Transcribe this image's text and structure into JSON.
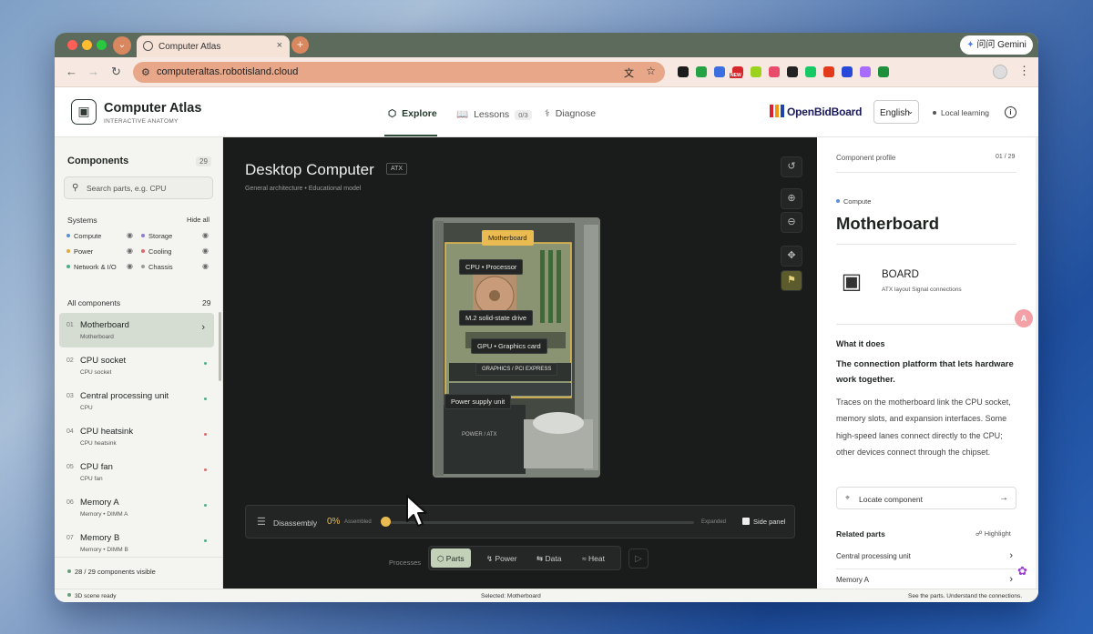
{
  "browser": {
    "tab_title": "Computer Atlas",
    "tab_close": "×",
    "new_tab": "+",
    "address": "computeraltas.robotisland.cloud",
    "gemini_label": "问问 Gemini",
    "traffic_colors": [
      "#ff5f57",
      "#febc2e",
      "#28c840"
    ],
    "extension_colors": [
      "#1b1b1b",
      "#25a244",
      "#3b6fe0",
      "#d6262b",
      "#9bd31c",
      "#e94b6a",
      "#222222",
      "#17c964",
      "#e33a1c",
      "#2748d8",
      "#a76bff",
      "#1e8f3c"
    ],
    "new_badge": "NEW"
  },
  "app": {
    "brand": "Computer Atlas",
    "brand_sub": "INTERACTIVE ANATOMY",
    "nav": [
      {
        "label": "Explore",
        "icon": "cube-icon",
        "active": true
      },
      {
        "label": "Lessons",
        "icon": "book-icon",
        "badge": "0/3"
      },
      {
        "label": "Diagnose",
        "icon": "stethoscope-icon"
      }
    ],
    "partner": "OpenBidBoard",
    "language": "English",
    "local_learning": "Local learning",
    "info": "i"
  },
  "sidebar": {
    "title": "Components",
    "count": "29",
    "search_placeholder": "Search parts, e.g. CPU",
    "systems_label": "Systems",
    "hide_all": "Hide all",
    "systems": [
      {
        "label": "Compute",
        "color": "#5b8fd6"
      },
      {
        "label": "Storage",
        "color": "#8f7ad6"
      },
      {
        "label": "Power",
        "color": "#e0a93a"
      },
      {
        "label": "Cooling",
        "color": "#d96b6b"
      },
      {
        "label": "Network & I/O",
        "color": "#4cae8a"
      },
      {
        "label": "Chassis",
        "color": "#9a9a9a"
      }
    ],
    "all_label": "All components",
    "all_count": "29",
    "items": [
      {
        "num": "01",
        "name": "Motherboard",
        "sub": "Motherboard",
        "selected": true
      },
      {
        "num": "02",
        "name": "CPU socket",
        "sub": "CPU socket",
        "color": "#4cae8a"
      },
      {
        "num": "03",
        "name": "Central processing unit",
        "sub": "CPU",
        "color": "#4cae8a"
      },
      {
        "num": "04",
        "name": "CPU heatsink",
        "sub": "CPU heatsink",
        "color": "#d96b6b"
      },
      {
        "num": "05",
        "name": "CPU fan",
        "sub": "CPU fan",
        "color": "#d96b6b"
      },
      {
        "num": "06",
        "name": "Memory A",
        "sub": "Memory  •  DIMM A",
        "color": "#4cae8a"
      },
      {
        "num": "07",
        "name": "Memory B",
        "sub": "Memory  •  DIMM B",
        "color": "#4cae8a"
      }
    ],
    "visible_text": "28 / 29 components visible"
  },
  "viewer": {
    "title": "Desktop Computer",
    "badge": "ATX",
    "subtitle": "General architecture  •  Educational model",
    "labels": {
      "motherboard": "Motherboard",
      "cpu": "CPU  •  Processor",
      "m2": "M.2 solid-state drive",
      "gpu": "GPU  •  Graphics card",
      "pcie": "GRAPHICS / PCI EXPRESS",
      "psu": "Power supply unit",
      "power_atx": "POWER / ATX"
    },
    "disassembly_label": "Disassembly",
    "disassembly_percent": "0%",
    "disassembly_value": 0,
    "assembled": "Assembled",
    "expanded": "Expanded",
    "side_panel": "Side panel",
    "processes_label": "Processes",
    "processes": [
      {
        "label": "Parts",
        "icon": "cube-icon",
        "active": true
      },
      {
        "label": "Power",
        "icon": "bolt-icon"
      },
      {
        "label": "Data",
        "icon": "arrows-icon"
      },
      {
        "label": "Heat",
        "icon": "wind-icon"
      }
    ]
  },
  "profile": {
    "header": "Component profile",
    "index": "01 / 29",
    "category": "Compute",
    "title": "Motherboard",
    "kind": "BOARD",
    "kind_sub": "ATX layout    Signal connections",
    "what_label": "What it does",
    "lead": "The connection platform that lets hardware work together.",
    "description": "Traces on the motherboard link the CPU socket, memory slots, and expansion interfaces. Some high-speed lanes connect directly to the CPU; other devices connect through the chipset.",
    "locate": "Locate component",
    "related_label": "Related parts",
    "highlight": "Highlight",
    "related": [
      "Central processing unit",
      "Memory A"
    ]
  },
  "status": {
    "left": "3D scene ready",
    "center": "Selected: Motherboard",
    "right": "See the parts. Understand the connections."
  }
}
